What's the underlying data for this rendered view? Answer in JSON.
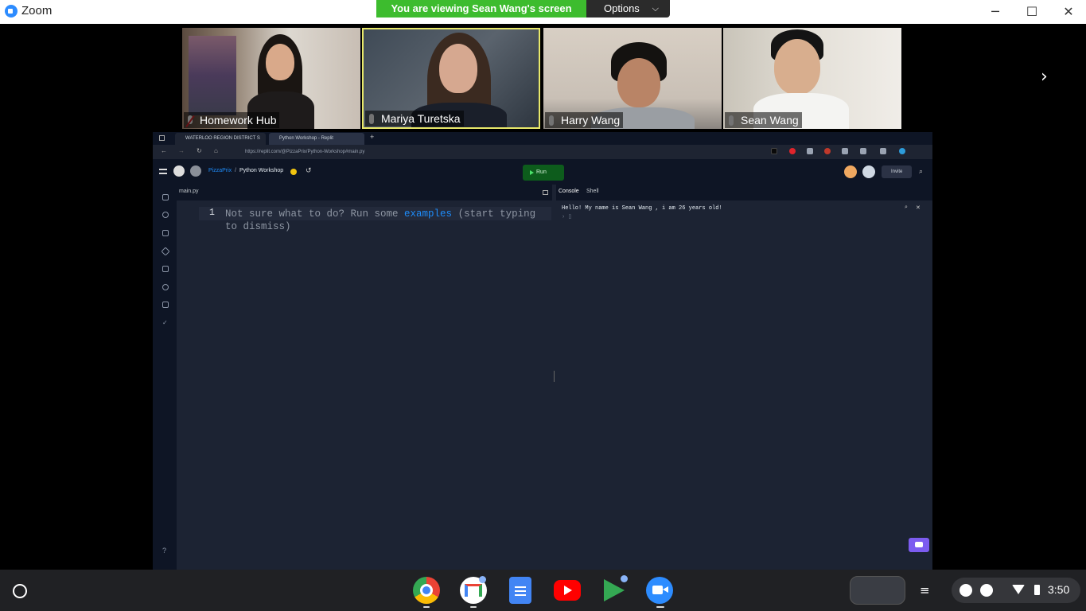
{
  "window": {
    "title": "Zoom",
    "minimize": "─",
    "maximize": "☐",
    "close": "✕"
  },
  "banner": {
    "viewing_text": "You are viewing Sean Wang's screen",
    "options_label": "Options"
  },
  "participants": [
    {
      "name": "Homework Hub",
      "muted": true
    },
    {
      "name": "Mariya Turetska",
      "muted": false,
      "active_speaker": true
    },
    {
      "name": "Harry Wang",
      "muted": false
    },
    {
      "name": "Sean Wang",
      "muted": false
    }
  ],
  "shared_screen": {
    "browser_tabs": [
      {
        "label": "WATERLOO REGION DISTRICT S"
      },
      {
        "label": "Python Workshop - Replit"
      }
    ],
    "new_tab": "+",
    "url": "https://replit.com/@PizzaPrix/Python-Workshop#main.py",
    "breadcrumb_owner": "PizzaPrix",
    "breadcrumb_sep": "/",
    "project_name": "Python Workshop",
    "run_label": "Run",
    "invite_label": "Invite",
    "editor_tab": "main.py",
    "line_number": "1",
    "hint_text_before": "Not sure what to do? Run some ",
    "hint_link": "examples",
    "hint_text_after": " (start typing to dismiss)",
    "console_tab": "Console",
    "shell_tab": "Shell",
    "console_output": "Hello! My name is Sean Wang , i am 26  years old!",
    "console_prompt": "› ▯",
    "help_icon": "?"
  },
  "shelf": {
    "apps": [
      "chrome-icon",
      "gmail-icon",
      "docs-icon",
      "youtube-icon",
      "play-store-icon",
      "zoom-icon"
    ],
    "clock": "3:50"
  },
  "colors": {
    "banner_green": "#3dbc2e",
    "active_border": "#e8e86a",
    "replit_bg": "#1c2333",
    "link_blue": "#1e8cfa"
  }
}
